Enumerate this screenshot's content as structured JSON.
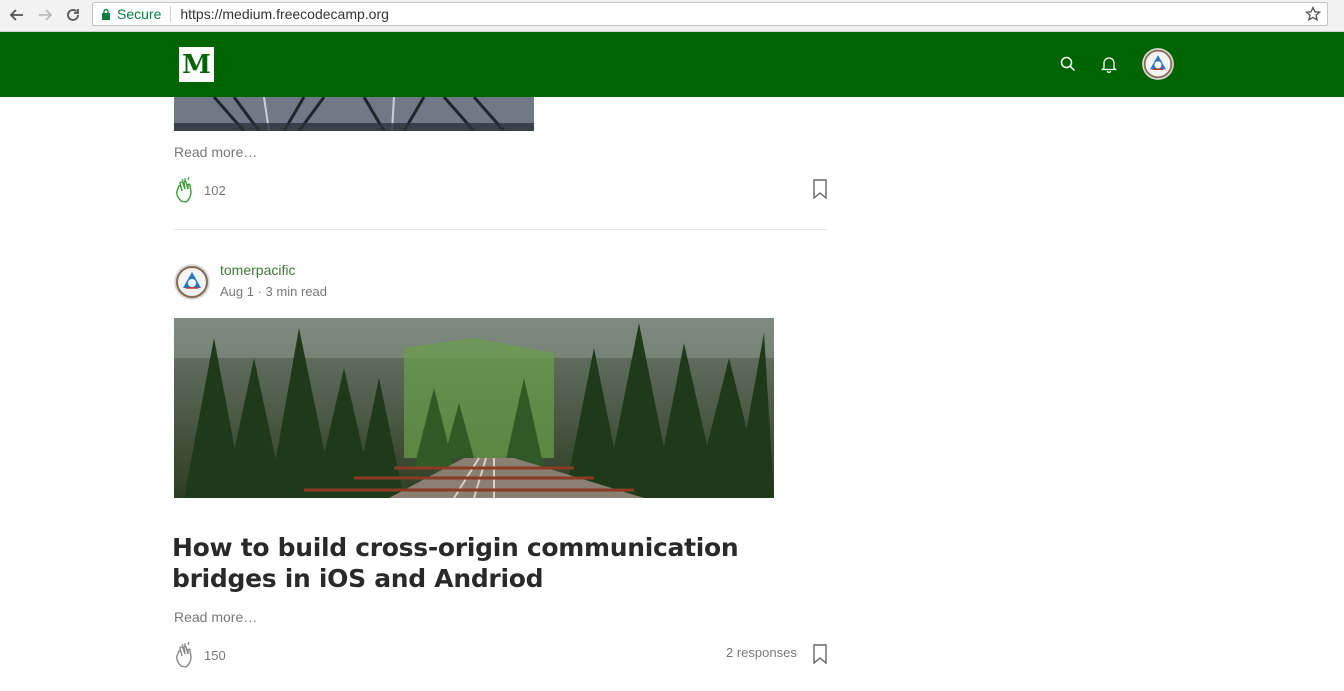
{
  "browser": {
    "secure_label": "Secure",
    "url": "https://medium.freecodecamp.org"
  },
  "site": {
    "logo_letter": "M",
    "header_color": "#006400"
  },
  "feed": {
    "previous_post": {
      "read_more": "Read more…",
      "claps": "102"
    },
    "post": {
      "author": "tomerpacific",
      "date": "Aug 1",
      "read_time": "3 min read",
      "meta_separator": " · ",
      "title": "How to build cross-origin communication bridges in iOS and Andriod",
      "read_more": "Read more…",
      "claps": "150",
      "responses": "2 responses"
    }
  },
  "colors": {
    "accent_green": "#3c7a33",
    "secure_green": "#0b8043"
  },
  "icons": {
    "back": "arrow-left-icon",
    "forward": "arrow-right-icon",
    "reload": "reload-icon",
    "lock": "lock-icon",
    "bookmark_star": "star-icon",
    "search": "search-icon",
    "notifications": "bell-icon",
    "clap": "clap-icon",
    "bookmark": "bookmark-icon"
  }
}
